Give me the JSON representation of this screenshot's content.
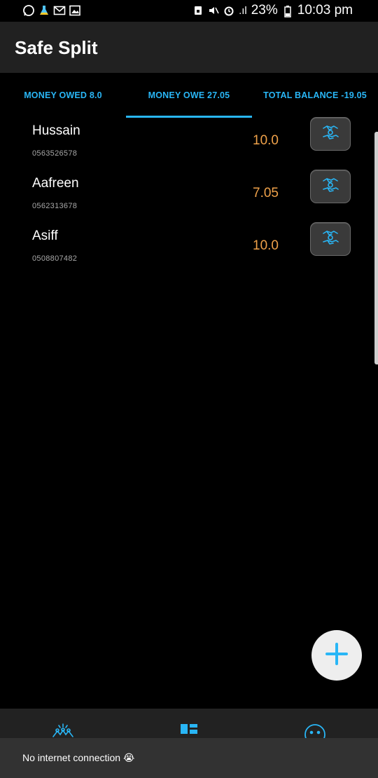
{
  "status_bar": {
    "battery": "23%",
    "time": "10:03 pm",
    "signal": ".ıl"
  },
  "app": {
    "title": "Safe Split"
  },
  "tabs": [
    {
      "label": "MONEY OWED 8.0",
      "selected": false
    },
    {
      "label": "MONEY OWE 27.05",
      "selected": true
    },
    {
      "label": "TOTAL BALANCE -19.05",
      "selected": false
    }
  ],
  "list": [
    {
      "name": "Hussain",
      "phone": "0563526578",
      "amount": "10.0",
      "icon": "handshake-money-icon"
    },
    {
      "name": "Aafreen",
      "phone": "0562313678",
      "amount": "7.05",
      "icon": "handshake-money-icon"
    },
    {
      "name": "Asiff",
      "phone": "0508807482",
      "amount": "10.0",
      "icon": "handshake-money-icon"
    }
  ],
  "fab": {
    "icon": "plus-icon"
  },
  "bottom_nav": [
    {
      "icon": "people-icon"
    },
    {
      "icon": "dashboard-icon"
    },
    {
      "icon": "face-icon"
    }
  ],
  "snackbar": {
    "text": "No internet connection 😭"
  },
  "colors": {
    "accent": "#29b6f6",
    "amount": "#f0a24a",
    "app_bar": "#212121",
    "snackbar": "#323232"
  }
}
